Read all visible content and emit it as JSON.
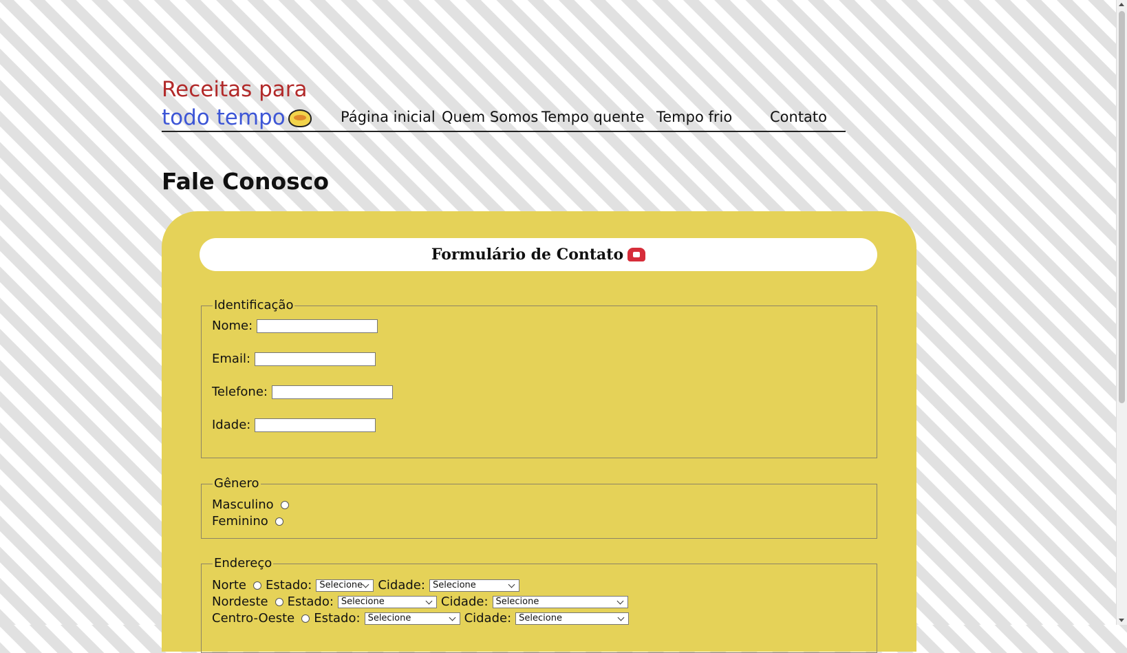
{
  "brand": {
    "line1": "Receitas para",
    "line2": "todo tempo"
  },
  "nav": {
    "home": "Página inicial",
    "about": "Quem Somos",
    "hot": "Tempo quente",
    "cold": "Tempo frio",
    "contact": "Contato"
  },
  "page": {
    "title": "Fale Conosco"
  },
  "form": {
    "title": "Formulário de Contato",
    "identificacao": {
      "legend": "Identificação",
      "nome": "Nome:",
      "email": "Email:",
      "telefone": "Telefone:",
      "idade": "Idade:",
      "nome_value": "",
      "email_value": "",
      "telefone_value": "",
      "idade_value": ""
    },
    "genero": {
      "legend": "Gênero",
      "masculino": "Masculino",
      "feminino": "Feminino"
    },
    "endereco": {
      "legend": "Endereço",
      "estado": "Estado:",
      "cidade": "Cidade:",
      "selecione": "Selecione",
      "regions": [
        "Norte",
        "Nordeste",
        "Centro-Oeste"
      ]
    }
  },
  "icons": {
    "brand": "pot-icon",
    "form": "phone-icon"
  },
  "colors": {
    "card": "#e5d258",
    "brand_red": "#b22a2a",
    "brand_blue": "#3d56d6"
  }
}
